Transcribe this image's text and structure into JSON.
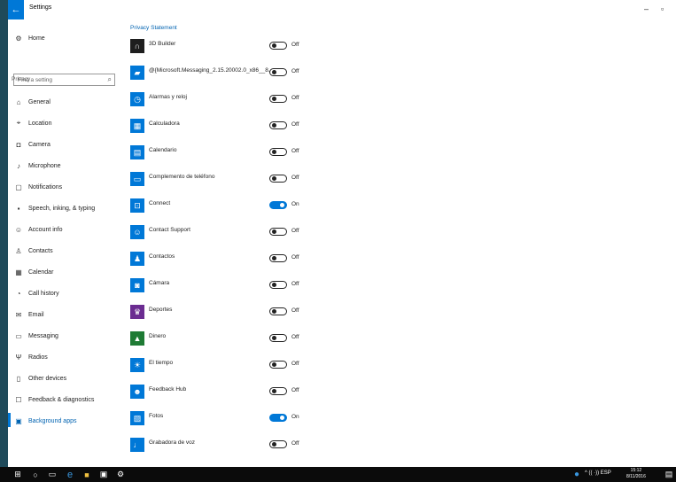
{
  "window": {
    "title": "Settings",
    "back_icon": "back-arrow-icon",
    "minimize": "–",
    "restore": "▫"
  },
  "sidebar": {
    "home": "Home",
    "search_placeholder": "Find a setting",
    "section": "Privacy",
    "items": [
      {
        "label": "General",
        "icon": "lock-icon"
      },
      {
        "label": "Location",
        "icon": "location-icon"
      },
      {
        "label": "Camera",
        "icon": "camera-icon"
      },
      {
        "label": "Microphone",
        "icon": "microphone-icon"
      },
      {
        "label": "Notifications",
        "icon": "notifications-icon"
      },
      {
        "label": "Speech, inking, & typing",
        "icon": "speech-icon"
      },
      {
        "label": "Account info",
        "icon": "account-info-icon"
      },
      {
        "label": "Contacts",
        "icon": "contacts-icon"
      },
      {
        "label": "Calendar",
        "icon": "calendar-icon"
      },
      {
        "label": "Call history",
        "icon": "call-history-icon"
      },
      {
        "label": "Email",
        "icon": "email-icon"
      },
      {
        "label": "Messaging",
        "icon": "messaging-icon"
      },
      {
        "label": "Radios",
        "icon": "radios-icon"
      },
      {
        "label": "Other devices",
        "icon": "other-devices-icon"
      },
      {
        "label": "Feedback & diagnostics",
        "icon": "feedback-icon"
      },
      {
        "label": "Background apps",
        "icon": "background-apps-icon"
      }
    ]
  },
  "main": {
    "privacy_link": "Privacy Statement",
    "apps": [
      {
        "name": "3D Builder",
        "state": "Off",
        "on": false,
        "color": "#1e1e1e",
        "icon": "3d-builder-icon"
      },
      {
        "name": "@{Microsoft.Messaging_2.15.20002.0_x86__8...",
        "state": "Off",
        "on": false,
        "color": "#0078d7",
        "icon": "messaging-app-icon"
      },
      {
        "name": "Alarmas y reloj",
        "state": "Off",
        "on": false,
        "color": "#0078d7",
        "icon": "alarm-clock-icon"
      },
      {
        "name": "Calculadora",
        "state": "Off",
        "on": false,
        "color": "#0078d7",
        "icon": "calculator-icon"
      },
      {
        "name": "Calendario",
        "state": "Off",
        "on": false,
        "color": "#0078d7",
        "icon": "calendar-app-icon"
      },
      {
        "name": "Complemento de teléfono",
        "state": "Off",
        "on": false,
        "color": "#0078d7",
        "icon": "phone-companion-icon"
      },
      {
        "name": "Connect",
        "state": "On",
        "on": true,
        "color": "#0078d7",
        "icon": "connect-icon"
      },
      {
        "name": "Contact Support",
        "state": "Off",
        "on": false,
        "color": "#0078d7",
        "icon": "contact-support-icon"
      },
      {
        "name": "Contactos",
        "state": "Off",
        "on": false,
        "color": "#0078d7",
        "icon": "people-icon"
      },
      {
        "name": "Cámara",
        "state": "Off",
        "on": false,
        "color": "#0078d7",
        "icon": "camera-app-icon"
      },
      {
        "name": "Deportes",
        "state": "Off",
        "on": false,
        "color": "#6b2c91",
        "icon": "sports-icon"
      },
      {
        "name": "Dinero",
        "state": "Off",
        "on": false,
        "color": "#1e7b34",
        "icon": "money-icon"
      },
      {
        "name": "El tiempo",
        "state": "Off",
        "on": false,
        "color": "#0078d7",
        "icon": "weather-icon"
      },
      {
        "name": "Feedback Hub",
        "state": "Off",
        "on": false,
        "color": "#0078d7",
        "icon": "feedback-hub-icon"
      },
      {
        "name": "Fotos",
        "state": "On",
        "on": true,
        "color": "#0078d7",
        "icon": "photos-icon"
      },
      {
        "name": "Grabadora de voz",
        "state": "Off",
        "on": false,
        "color": "#0078d7",
        "icon": "voice-recorder-icon"
      }
    ]
  },
  "taskbar": {
    "tray": "^ (( ·)) ESP",
    "clock_time": "15:12",
    "clock_date": "8/11/2016"
  },
  "colors": {
    "accent": "#0078d7",
    "taskbar": "#0b0b0b"
  }
}
